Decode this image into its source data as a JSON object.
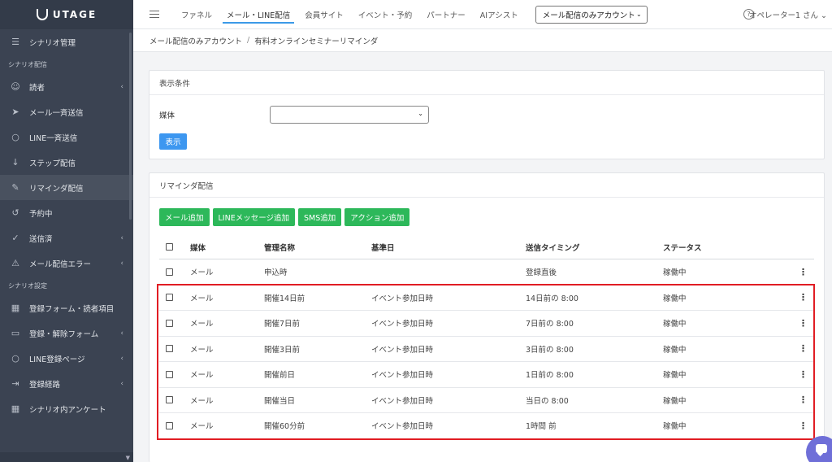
{
  "app": {
    "logo_text": "UTAGE"
  },
  "sidebar": {
    "top_item": {
      "label": "シナリオ管理",
      "icon": "list-icon"
    },
    "section1": "シナリオ配信",
    "items1": [
      {
        "label": "読者",
        "icon": "users-icon",
        "chevron": "‹"
      },
      {
        "label": "メール一斉送信",
        "icon": "send-icon",
        "chevron": ""
      },
      {
        "label": "LINE一斉送信",
        "icon": "chat-icon",
        "chevron": ""
      },
      {
        "label": "ステップ配信",
        "icon": "sort-icon",
        "chevron": ""
      },
      {
        "label": "リマインダ配信",
        "icon": "pencil-icon",
        "chevron": ""
      },
      {
        "label": "予約中",
        "icon": "history-icon",
        "chevron": ""
      },
      {
        "label": "送信済",
        "icon": "check-send-icon",
        "chevron": "‹"
      },
      {
        "label": "メール配信エラー",
        "icon": "warning-icon",
        "chevron": "‹"
      }
    ],
    "section2": "シナリオ設定",
    "items2": [
      {
        "label": "登録フォーム・読者項目",
        "icon": "table-icon",
        "chevron": ""
      },
      {
        "label": "登録・解除フォーム",
        "icon": "form-icon",
        "chevron": "‹"
      },
      {
        "label": "LINE登録ページ",
        "icon": "chat-icon",
        "chevron": "‹"
      },
      {
        "label": "登録経路",
        "icon": "route-icon",
        "chevron": "‹"
      },
      {
        "label": "シナリオ内アンケート",
        "icon": "table-icon",
        "chevron": ""
      }
    ]
  },
  "topbar": {
    "tabs": [
      "ファネル",
      "メール・LINE配信",
      "会員サイト",
      "イベント・予約",
      "パートナー",
      "AIアシスト"
    ],
    "active_tab": 1,
    "account_select": "メール配信のみアカウント",
    "operator": "オペレーター1 さん ⌄"
  },
  "breadcrumb": {
    "parent": "メール配信のみアカウント",
    "sep": "/",
    "current": "有料オンラインセミナーリマインダ"
  },
  "filter_card": {
    "title": "表示条件",
    "media_label": "媒体",
    "media_value": "",
    "show_button": "表示"
  },
  "reminder_card": {
    "title": "リマインダ配信",
    "buttons": [
      "メール追加",
      "LINEメッセージ追加",
      "SMS追加",
      "アクション追加"
    ],
    "columns": {
      "media": "媒体",
      "name": "管理名称",
      "base": "基準日",
      "timing": "送信タイミング",
      "status": "ステータス"
    },
    "rows": [
      {
        "media": "メール",
        "name": "申込時",
        "base": "",
        "timing": "登録直後",
        "status": "稼働中"
      },
      {
        "media": "メール",
        "name": "開催14日前",
        "base": "イベント参加日時",
        "timing": "14日前の 8:00",
        "status": "稼働中"
      },
      {
        "media": "メール",
        "name": "開催7日前",
        "base": "イベント参加日時",
        "timing": "7日前の 8:00",
        "status": "稼働中"
      },
      {
        "media": "メール",
        "name": "開催3日前",
        "base": "イベント参加日時",
        "timing": "3日前の 8:00",
        "status": "稼働中"
      },
      {
        "media": "メール",
        "name": "開催前日",
        "base": "イベント参加日時",
        "timing": "1日前の 8:00",
        "status": "稼働中"
      },
      {
        "media": "メール",
        "name": "開催当日",
        "base": "イベント参加日時",
        "timing": "当日の 8:00",
        "status": "稼働中"
      },
      {
        "media": "メール",
        "name": "開催60分前",
        "base": "イベント参加日時",
        "timing": "1時間 前",
        "status": "稼働中"
      }
    ]
  },
  "colors": {
    "sidebar_bg": "#3b4352",
    "accent_blue": "#3d97f0",
    "green": "#2db85a",
    "highlight_red": "#e11d24"
  }
}
